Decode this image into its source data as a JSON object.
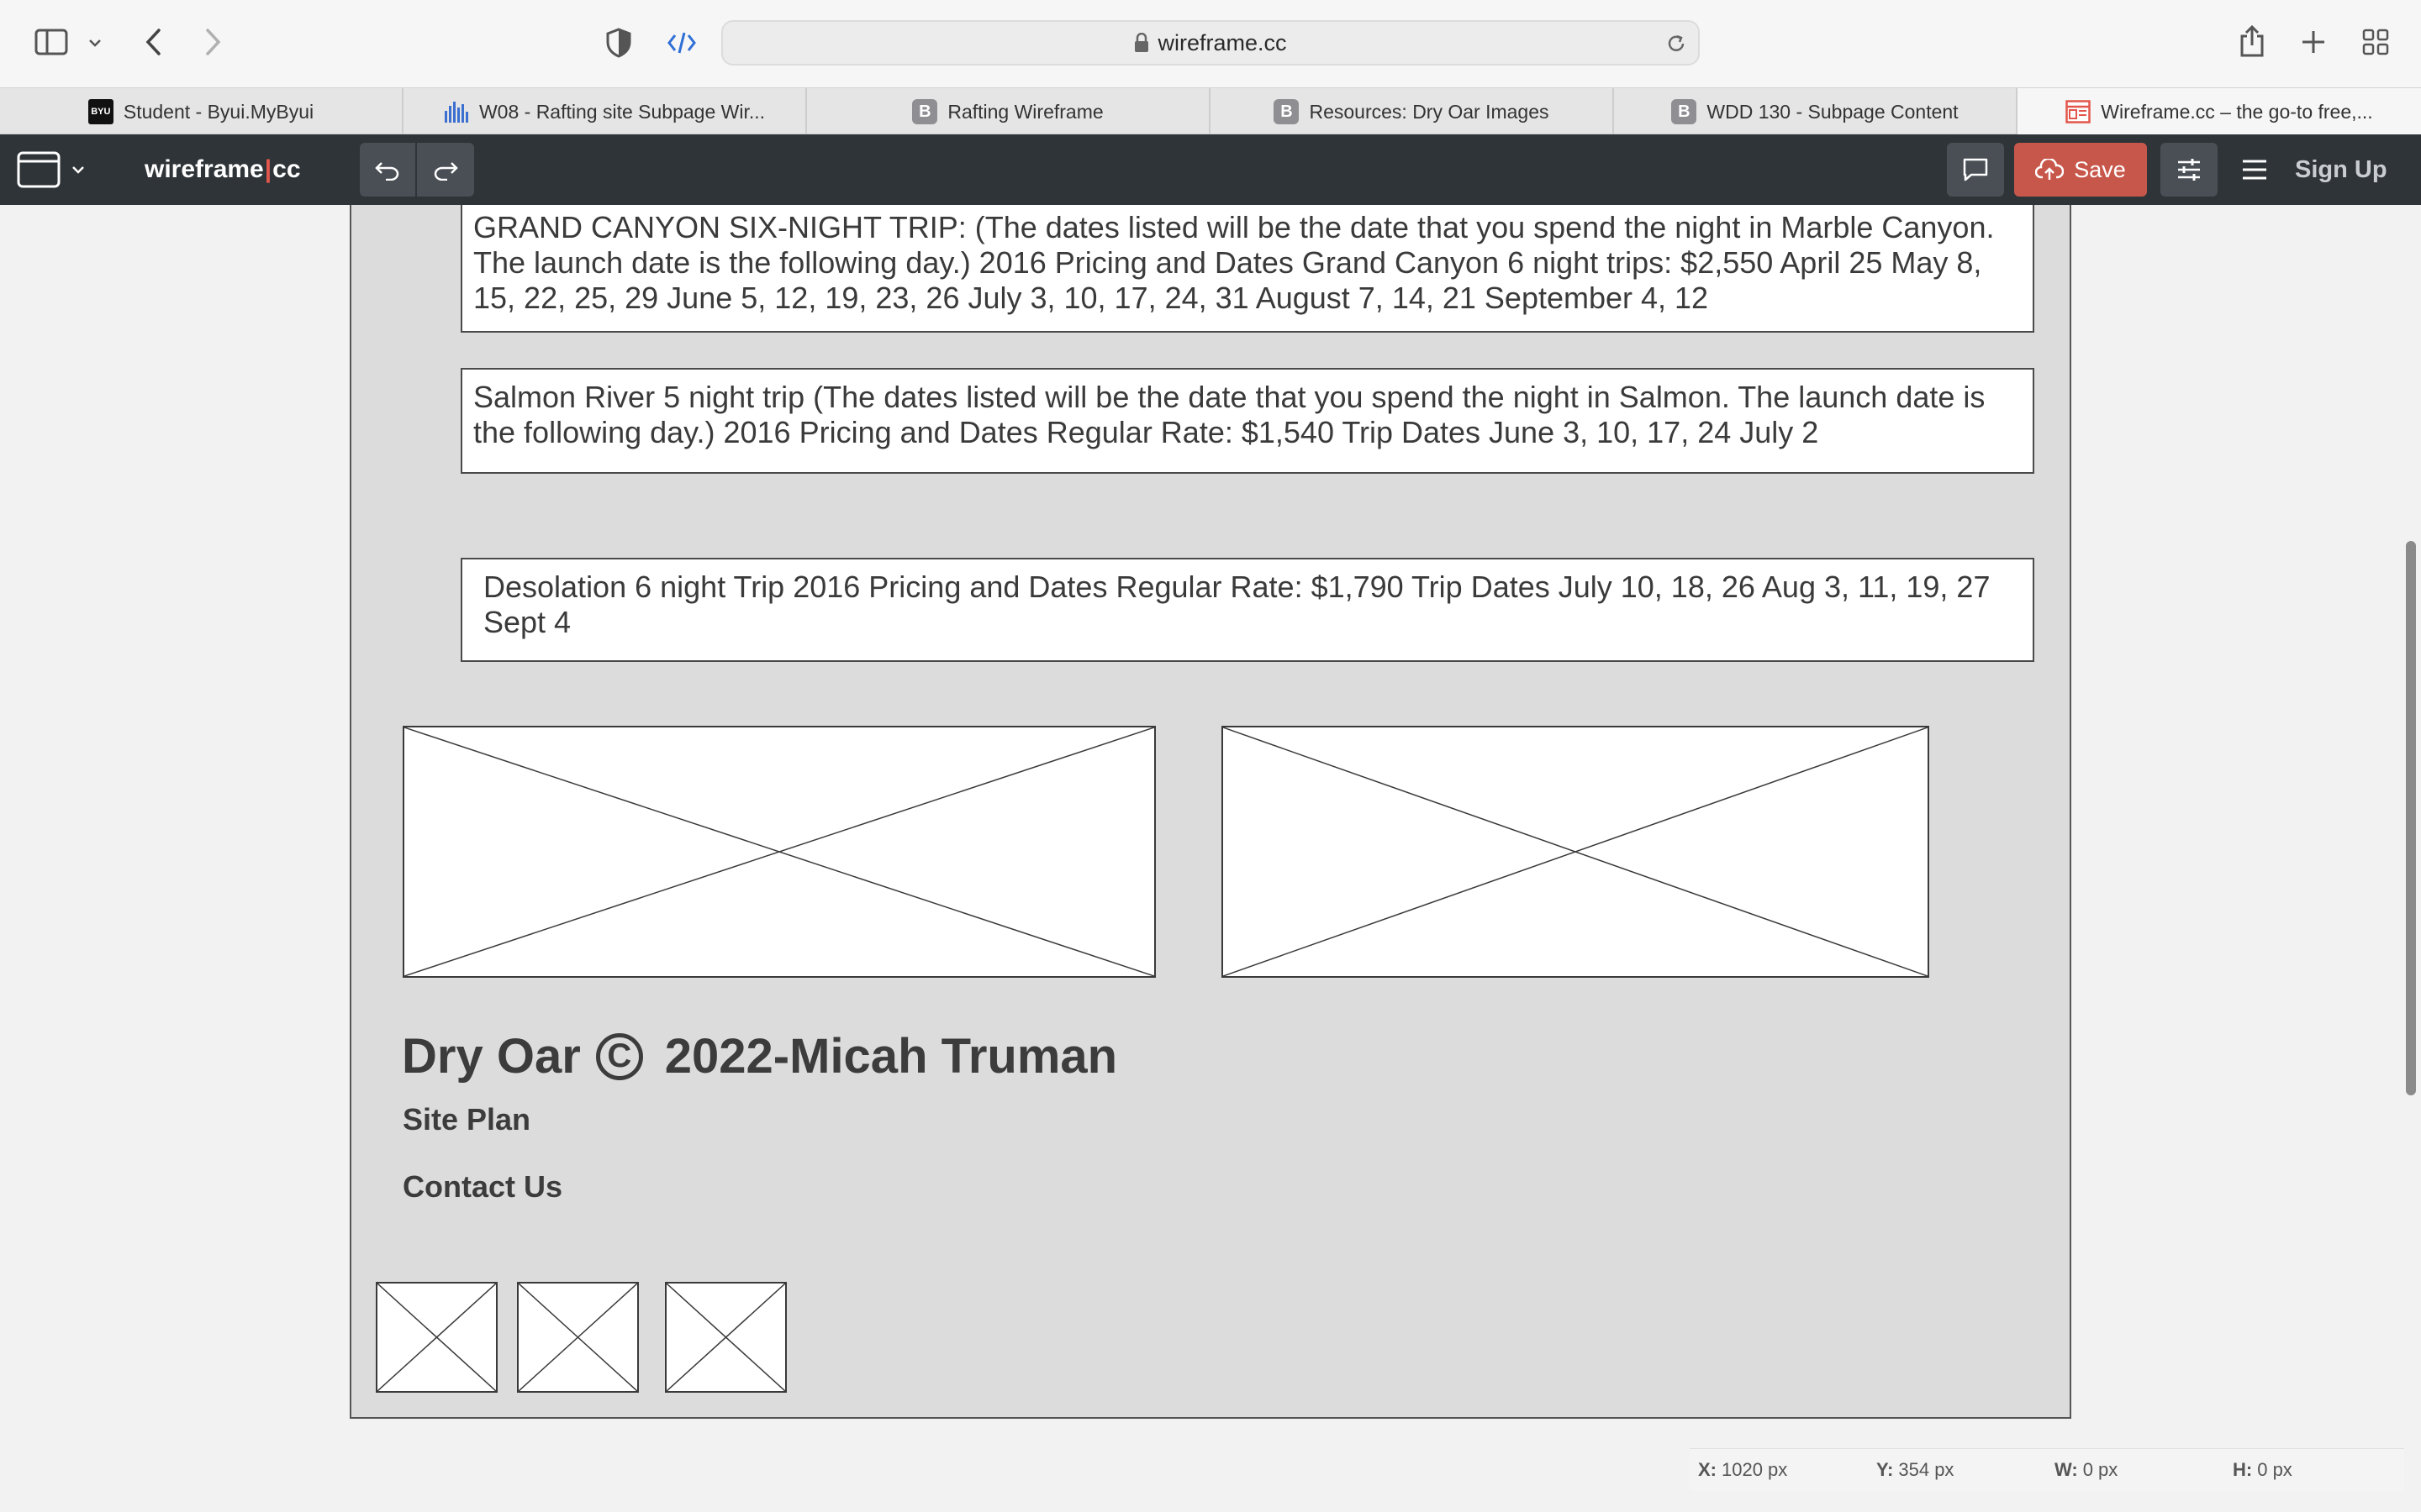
{
  "browser": {
    "url": "wireframe.cc",
    "tabs": [
      {
        "label": "Student - Byui.MyByui",
        "favicon": "byu-icon"
      },
      {
        "label": "W08 - Rafting site Subpage Wir...",
        "favicon": "bars-icon"
      },
      {
        "label": "Rafting Wireframe",
        "favicon": "b-icon"
      },
      {
        "label": "Resources: Dry Oar Images",
        "favicon": "b-icon"
      },
      {
        "label": "WDD 130 - Subpage Content",
        "favicon": "b-icon"
      },
      {
        "label": "Wireframe.cc – the go-to free,...",
        "favicon": "wireframe-icon"
      }
    ],
    "active_tab_index": 5,
    "byu_badge": "BYU"
  },
  "app": {
    "brand_left": "wireframe",
    "brand_sep": "|",
    "brand_right": "cc",
    "save_label": "Save",
    "signup_label": "Sign Up"
  },
  "canvas": {
    "paragraphs": [
      "GRAND CANYON SIX-NIGHT TRIP: (The dates listed will be the date that you spend the night in Marble Canyon. The launch date is the following day.) 2016 Pricing and Dates Grand Canyon 6 night trips: $2,550 April 25 May 8, 15, 22, 25, 29 June 5, 12, 19, 23, 26 July 3, 10, 17, 24, 31 August 7, 14, 21 September 4, 12",
      "Salmon River 5 night trip (The dates listed will be the date that you spend the night in Salmon. The launch date is the following day.) 2016 Pricing and Dates Regular Rate: $1,540 Trip Dates June 3, 10, 17, 24 July 2",
      "Desolation 6 night Trip 2016 Pricing and Dates Regular Rate: $1,790 Trip Dates July 10, 18, 26 Aug 3, 11, 19, 27 Sept 4"
    ],
    "footer": {
      "brand": "Dry Oar",
      "copyright_symbol": "C",
      "year_author": "2022-Micah Truman",
      "links": [
        "Site Plan",
        "Contact Us"
      ]
    }
  },
  "status": {
    "x_label": "X:",
    "x_value": "1020 px",
    "y_label": "Y:",
    "y_value": "354 px",
    "w_label": "W:",
    "w_value": "0 px",
    "h_label": "H:",
    "h_value": "0 px"
  },
  "colors": {
    "app_bar": "#2f3438",
    "save_button": "#c8574b",
    "brand_separator": "#e2574c",
    "canvas_page": "#dcdcdc"
  }
}
